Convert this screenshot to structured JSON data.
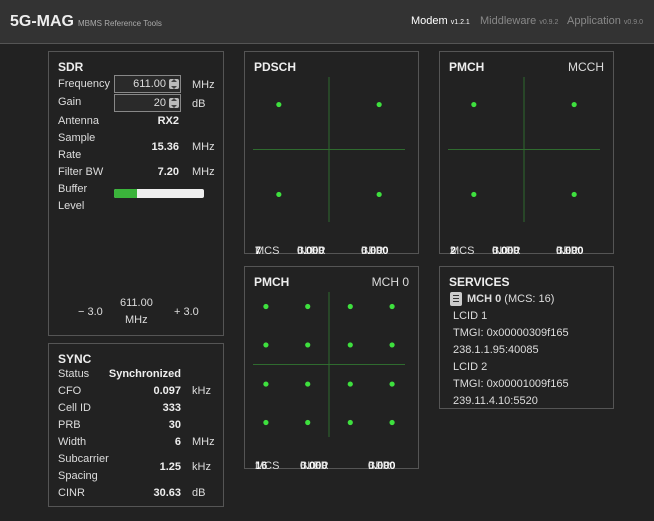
{
  "nav": {
    "brand": "5G-MAG",
    "brand_sub": "MBMS Reference Tools",
    "modem_label": "Modem",
    "modem_ver": "v1.2.1",
    "middleware_label": "Middleware",
    "middleware_ver": "v0.9.2",
    "application_label": "Application",
    "application_ver": "v0.9.0"
  },
  "sdr": {
    "title": "SDR",
    "frequency_label": "Frequency",
    "frequency_value": "611.00",
    "frequency_unit": "MHz",
    "gain_label": "Gain",
    "gain_value": "20",
    "gain_unit": "dB",
    "antenna_label": "Antenna",
    "antenna_value": "RX2",
    "sample_rate_label_1": "Sample",
    "sample_rate_label_2": "Rate",
    "sample_rate_value": "15.36",
    "sample_rate_unit": "MHz",
    "filter_bw_label": "Filter BW",
    "filter_bw_value": "7.20",
    "filter_bw_unit": "MHz",
    "buffer_label_1": "Buffer",
    "buffer_label_2": "Level",
    "buffer_fill_percent": 25,
    "axis_left": "− 3.0",
    "axis_center_1": "611.00",
    "axis_center_2": "MHz",
    "axis_right": "+ 3.0"
  },
  "sync": {
    "title": "SYNC",
    "status_label": "Status",
    "status_value": "Synchronized",
    "cfo_label": "CFO",
    "cfo_value": "0.097",
    "cfo_unit": "kHz",
    "cellid_label": "Cell ID",
    "cellid_value": "333",
    "prb_label": "PRB",
    "prb_value": "30",
    "width_label": "Width",
    "width_value": "6",
    "width_unit": "MHz",
    "scs_label_1": "Subcarrier",
    "scs_label_2": "Spacing",
    "scs_value": "1.25",
    "scs_unit": "kHz",
    "cinr_label": "CINR",
    "cinr_value": "30.63",
    "cinr_unit": "dB"
  },
  "pdsch": {
    "title": "PDSCH",
    "mcs_label": "MCS",
    "mcs_value": "7",
    "bler_label": "BLER",
    "bler_value": "0.000",
    "ber_label": "BER",
    "ber_value": "0.000"
  },
  "pmch_mcch": {
    "title": "PMCH",
    "subtitle": "MCCH",
    "mcs_label": "MCS",
    "mcs_value": "2",
    "bler_label": "BLER",
    "bler_value": "0.000",
    "ber_label": "BER",
    "ber_value": "0.000"
  },
  "pmch_mch0": {
    "title": "PMCH",
    "subtitle": "MCH 0",
    "mcs_label": "MCS",
    "mcs_value": "16",
    "bler_label": "BLER",
    "bler_value": "0.000",
    "ber_label": "BER",
    "ber_value": "0.000"
  },
  "services": {
    "title": "SERVICES",
    "mch_name": "MCH 0",
    "mch_mcs": "(MCS: 16)",
    "lcid1": "LCID 1",
    "tmgi1": "TMGI: 0x00000309f165",
    "addr1": "238.1.1.95:40085",
    "lcid2": "LCID 2",
    "tmgi2": "TMGI: 0x00001009f165",
    "addr2": "239.11.4.10:5520"
  },
  "colors": {
    "accent_green": "#3bb43b",
    "constellation_point": "#3ee03e",
    "axis_line": "#2f6b2f"
  },
  "constellation": {
    "qpsk": [
      [
        -0.66,
        0.62
      ],
      [
        0.66,
        0.62
      ],
      [
        -0.66,
        -0.62
      ],
      [
        0.66,
        -0.62
      ]
    ],
    "qam16": [
      [
        -0.83,
        0.8
      ],
      [
        -0.28,
        0.8
      ],
      [
        0.28,
        0.8
      ],
      [
        0.83,
        0.8
      ],
      [
        -0.83,
        0.27
      ],
      [
        -0.28,
        0.27
      ],
      [
        0.28,
        0.27
      ],
      [
        0.83,
        0.27
      ],
      [
        -0.83,
        -0.27
      ],
      [
        -0.28,
        -0.27
      ],
      [
        0.28,
        -0.27
      ],
      [
        0.83,
        -0.27
      ],
      [
        -0.83,
        -0.8
      ],
      [
        -0.28,
        -0.8
      ],
      [
        0.28,
        -0.8
      ],
      [
        0.83,
        -0.8
      ]
    ]
  }
}
